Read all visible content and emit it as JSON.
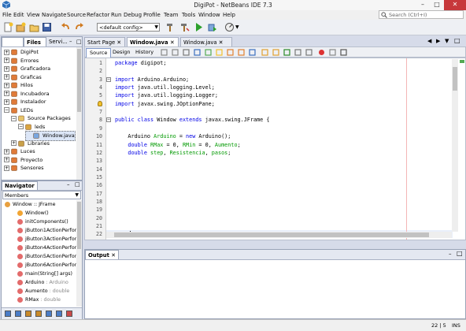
{
  "window": {
    "title": "DigiPot - NetBeans IDE 7.3",
    "minimize": "–",
    "maximize": "□",
    "close": "✕"
  },
  "menu": [
    "File",
    "Edit",
    "View",
    "Navigate",
    "Source",
    "Refactor",
    "Run",
    "Debug",
    "Profile",
    "Team",
    "Tools",
    "Window",
    "Help"
  ],
  "search": {
    "placeholder": "Search (Ctrl+I)"
  },
  "toolbar": {
    "config": "<default config>"
  },
  "projects_panel": {
    "tabs": [
      "Files",
      "Servi...",
      "–",
      "□"
    ],
    "tree": [
      {
        "label": "DigiPot",
        "expander": "+"
      },
      {
        "label": "Errores",
        "expander": "+"
      },
      {
        "label": "Graficadora",
        "expander": "+"
      },
      {
        "label": "Graficas",
        "expander": "+"
      },
      {
        "label": "Hilos",
        "expander": "+"
      },
      {
        "label": "Incubadora",
        "expander": "+"
      },
      {
        "label": "Instalador",
        "expander": "+"
      },
      {
        "label": "LEDs",
        "expander": "−"
      },
      {
        "label": "Source Packages",
        "expander": "−"
      },
      {
        "label": "leds",
        "expander": "−"
      },
      {
        "label": "Window.java",
        "expander": ""
      },
      {
        "label": "Libraries",
        "expander": "+"
      },
      {
        "label": "Luces",
        "expander": "+"
      },
      {
        "label": "Proyecto",
        "expander": "+"
      },
      {
        "label": "Sensores",
        "expander": "+"
      }
    ]
  },
  "navigator": {
    "title": "Navigator",
    "filter": "Members",
    "items": [
      {
        "name": "Window :: JFrame",
        "type": ""
      },
      {
        "name": "Window()",
        "type": ""
      },
      {
        "name": "initComponents()",
        "type": ""
      },
      {
        "name": "jButton1ActionPerfor",
        "type": ""
      },
      {
        "name": "jButton3ActionPerfor",
        "type": ""
      },
      {
        "name": "jButton4ActionPerfor",
        "type": ""
      },
      {
        "name": "jButton5ActionPerfor",
        "type": ""
      },
      {
        "name": "jButton6ActionPerfor",
        "type": ""
      },
      {
        "name": "main(String[] args)",
        "type": ""
      },
      {
        "name": "Arduino",
        "type": " : Arduino"
      },
      {
        "name": "Aumento",
        "type": " : double"
      },
      {
        "name": "RMax",
        "type": " : double"
      }
    ]
  },
  "editor": {
    "tabs": [
      "Start Page",
      "Window.java",
      "Window.java"
    ],
    "view_tabs": [
      "Source",
      "Design",
      "History"
    ],
    "lines": [
      [
        {
          "t": "package",
          "c": "kw"
        },
        {
          "t": " digipot;",
          "c": ""
        }
      ],
      [],
      [
        {
          "t": "import",
          "c": "kw"
        },
        {
          "t": " Arduino.Arduino;",
          "c": ""
        }
      ],
      [
        {
          "t": "import",
          "c": "kw"
        },
        {
          "t": " java.util.logging.Level;",
          "c": ""
        }
      ],
      [
        {
          "t": "import",
          "c": "kw"
        },
        {
          "t": " java.util.logging.Logger;",
          "c": ""
        }
      ],
      [
        {
          "t": "import",
          "c": "kw"
        },
        {
          "t": " javax.swing.JOptionPane;",
          "c": ""
        }
      ],
      [],
      [
        {
          "t": "public class",
          "c": "kw"
        },
        {
          "t": " Window ",
          "c": ""
        },
        {
          "t": "extends",
          "c": "kw"
        },
        {
          "t": " javax.swing.JFrame {",
          "c": ""
        }
      ],
      [],
      [
        {
          "t": "    Arduino ",
          "c": ""
        },
        {
          "t": "Arduino",
          "c": "fld"
        },
        {
          "t": " = ",
          "c": ""
        },
        {
          "t": "new",
          "c": "kw"
        },
        {
          "t": " Arduino();",
          "c": ""
        }
      ],
      [
        {
          "t": "    ",
          "c": ""
        },
        {
          "t": "double",
          "c": "kw"
        },
        {
          "t": " ",
          "c": ""
        },
        {
          "t": "RMax",
          "c": "fld"
        },
        {
          "t": " = 0, ",
          "c": ""
        },
        {
          "t": "RMin",
          "c": "fld"
        },
        {
          "t": " = 0, ",
          "c": ""
        },
        {
          "t": "Aumento",
          "c": "fld"
        },
        {
          "t": ";",
          "c": ""
        }
      ],
      [
        {
          "t": "    ",
          "c": ""
        },
        {
          "t": "double",
          "c": "kw"
        },
        {
          "t": " ",
          "c": ""
        },
        {
          "t": "step",
          "c": "fld"
        },
        {
          "t": ", ",
          "c": ""
        },
        {
          "t": "Resistencia",
          "c": "fld"
        },
        {
          "t": ", ",
          "c": ""
        },
        {
          "t": "pasos",
          "c": "fld"
        },
        {
          "t": ";",
          "c": ""
        }
      ],
      [],
      [],
      [],
      [],
      [],
      [],
      [],
      [],
      [],
      []
    ]
  },
  "output": {
    "title": "Output"
  },
  "status": {
    "position": "22 | 5",
    "mode": "INS"
  },
  "colors": {
    "keyword": "#0000e6",
    "field": "#009900",
    "close": "#c7383b"
  }
}
